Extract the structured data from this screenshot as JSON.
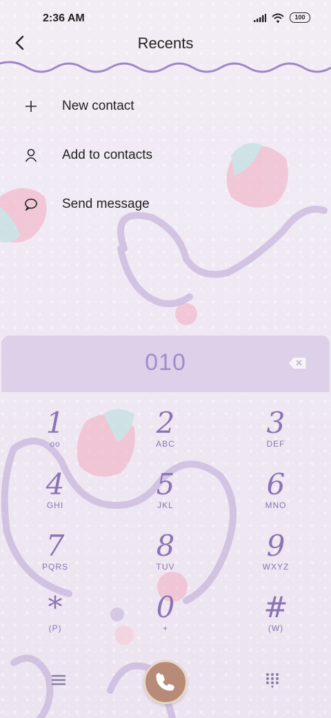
{
  "status": {
    "time": "2:36 AM",
    "battery": "100"
  },
  "header": {
    "title": "Recents"
  },
  "menu": [
    {
      "label": "New contact",
      "icon": "plus-icon"
    },
    {
      "label": "Add to contacts",
      "icon": "person-icon"
    },
    {
      "label": "Send message",
      "icon": "message-icon"
    }
  ],
  "dialer": {
    "number": "010",
    "keys": [
      {
        "digit": "1",
        "letters": "oo"
      },
      {
        "digit": "2",
        "letters": "ABC"
      },
      {
        "digit": "3",
        "letters": "DEF"
      },
      {
        "digit": "4",
        "letters": "GHI"
      },
      {
        "digit": "5",
        "letters": "JKL"
      },
      {
        "digit": "6",
        "letters": "MNO"
      },
      {
        "digit": "7",
        "letters": "PQRS"
      },
      {
        "digit": "8",
        "letters": "TUV"
      },
      {
        "digit": "9",
        "letters": "WXYZ"
      },
      {
        "digit": "*",
        "letters": "(P)"
      },
      {
        "digit": "0",
        "letters": "+"
      },
      {
        "digit": "#",
        "letters": "(W)"
      }
    ]
  },
  "colors": {
    "accent": "#8a74b4",
    "numberBar": "#dcd1e8",
    "callButton": "#b88a78"
  }
}
